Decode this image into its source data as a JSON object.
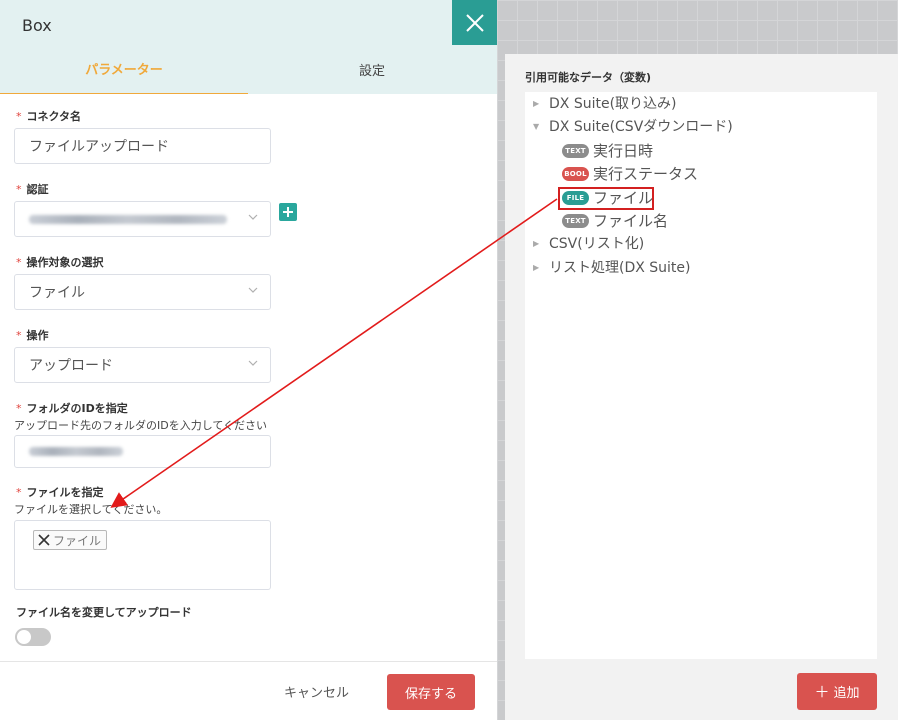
{
  "dialog": {
    "title": "Box",
    "tabs": [
      {
        "label": "パラメーター",
        "active": true
      },
      {
        "label": "設定",
        "active": false
      }
    ],
    "required_mark": "*",
    "fields": {
      "connector_name": {
        "label": "コネクタ名",
        "value": "ファイルアップロード"
      },
      "auth": {
        "label": "認証"
      },
      "target": {
        "label": "操作対象の選択",
        "value": "ファイル"
      },
      "operation": {
        "label": "操作",
        "value": "アップロード"
      },
      "folder_id": {
        "label": "フォルダのIDを指定",
        "help": "アップロード先のフォルダのIDを入力してください"
      },
      "file": {
        "label": "ファイルを指定",
        "help": "ファイルを選択してください。",
        "chip_label": "ファイル"
      },
      "rename": {
        "label": "ファイル名を変更してアップロード",
        "enabled": false
      }
    },
    "footer": {
      "cancel_label": "キャンセル",
      "save_label": "保存する"
    }
  },
  "side_panel": {
    "title": "引用可能なデータ（変数)",
    "tree": [
      {
        "label": "DX Suite(取り込み)",
        "expanded": false
      },
      {
        "label": "DX Suite(CSVダウンロード)",
        "expanded": true,
        "children": [
          {
            "type": "TEXT",
            "label": "実行日時"
          },
          {
            "type": "BOOL",
            "label": "実行ステータス"
          },
          {
            "type": "FILE",
            "label": "ファイル"
          },
          {
            "type": "TEXT",
            "label": "ファイル名"
          }
        ]
      },
      {
        "label": "CSV(リスト化)",
        "expanded": false
      },
      {
        "label": "リスト処理(DX Suite)",
        "expanded": false
      }
    ],
    "add_label": "追加"
  },
  "colors": {
    "accent": "#2a9d94",
    "tab_active": "#f0a93b",
    "danger": "#d9534f",
    "annotation": "#d32020"
  }
}
